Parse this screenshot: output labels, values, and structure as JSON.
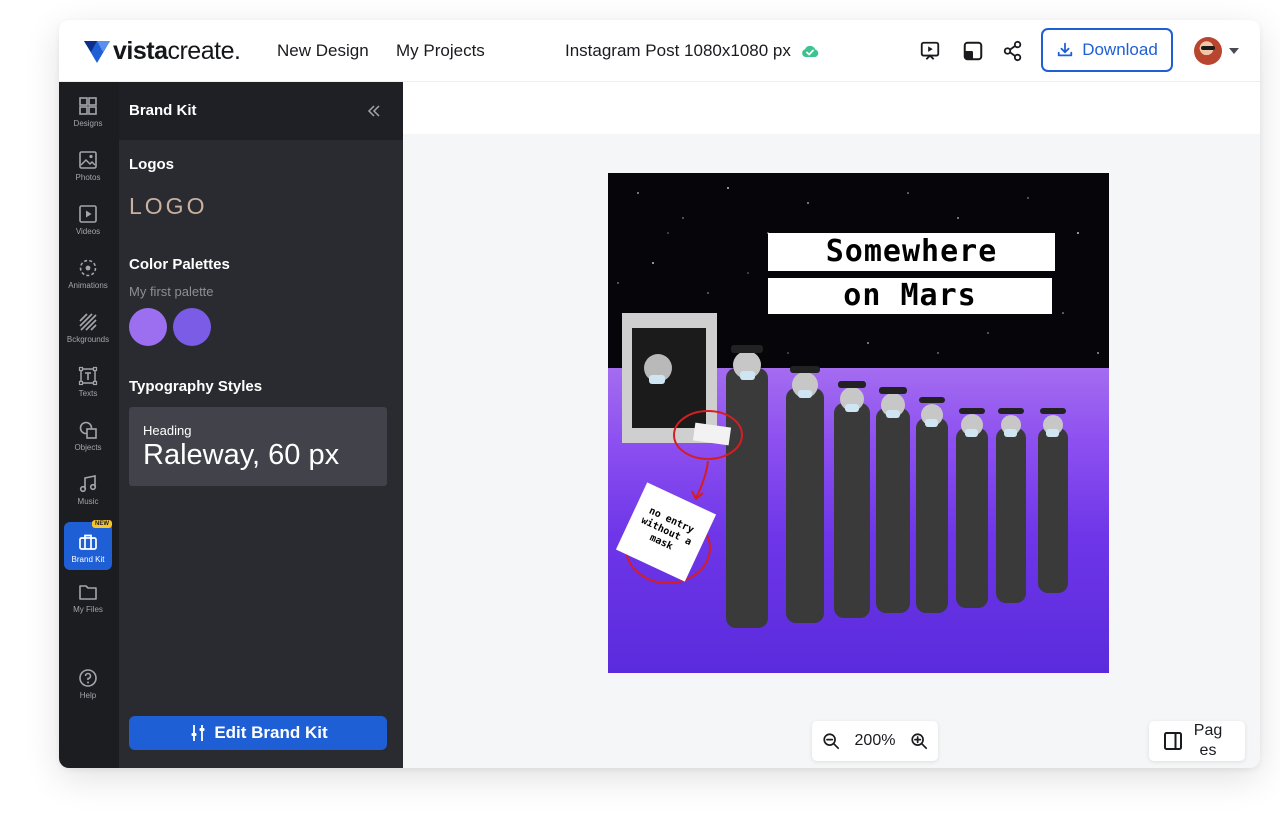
{
  "header": {
    "brand_bold": "vista",
    "brand_light": "create",
    "brand_mark": ".",
    "nav": [
      "New Design",
      "My Projects"
    ],
    "document_title": "Instagram Post 1080x1080 px",
    "download_label": "Download",
    "icons": [
      "play-preview-icon",
      "resize-icon",
      "share-icon",
      "download-icon",
      "cloud-check-icon"
    ]
  },
  "rail": {
    "items": [
      {
        "label": "Designs",
        "icon": "grid-icon"
      },
      {
        "label": "Photos",
        "icon": "image-icon"
      },
      {
        "label": "Videos",
        "icon": "video-icon"
      },
      {
        "label": "Animations",
        "icon": "animation-icon"
      },
      {
        "label": "Bckgrounds",
        "icon": "background-icon"
      },
      {
        "label": "Texts",
        "icon": "text-icon"
      },
      {
        "label": "Objects",
        "icon": "shapes-icon"
      },
      {
        "label": "Music",
        "icon": "music-icon"
      },
      {
        "label": "Brand Kit",
        "icon": "briefcase-icon",
        "active": true,
        "badge": "NEW"
      },
      {
        "label": "My Files",
        "icon": "folder-icon"
      },
      {
        "label": "Help",
        "icon": "help-icon"
      }
    ]
  },
  "panel": {
    "title": "Brand Kit",
    "logos_title": "Logos",
    "logo_placeholder": "LOGO",
    "palettes_title": "Color Palettes",
    "palette_name": "My first palette",
    "swatches": [
      "#9b6ff0",
      "#7b5ce6"
    ],
    "typography_title": "Typography Styles",
    "typography_label": "Heading",
    "typography_value": "Raleway, 60 px",
    "edit_button": "Edit Brand Kit"
  },
  "artboard": {
    "headline_line1": "Somewhere",
    "headline_line2": "on Mars",
    "sign_text": "no entry without a mask"
  },
  "footer": {
    "zoom": "200%",
    "pages": "Pages"
  }
}
